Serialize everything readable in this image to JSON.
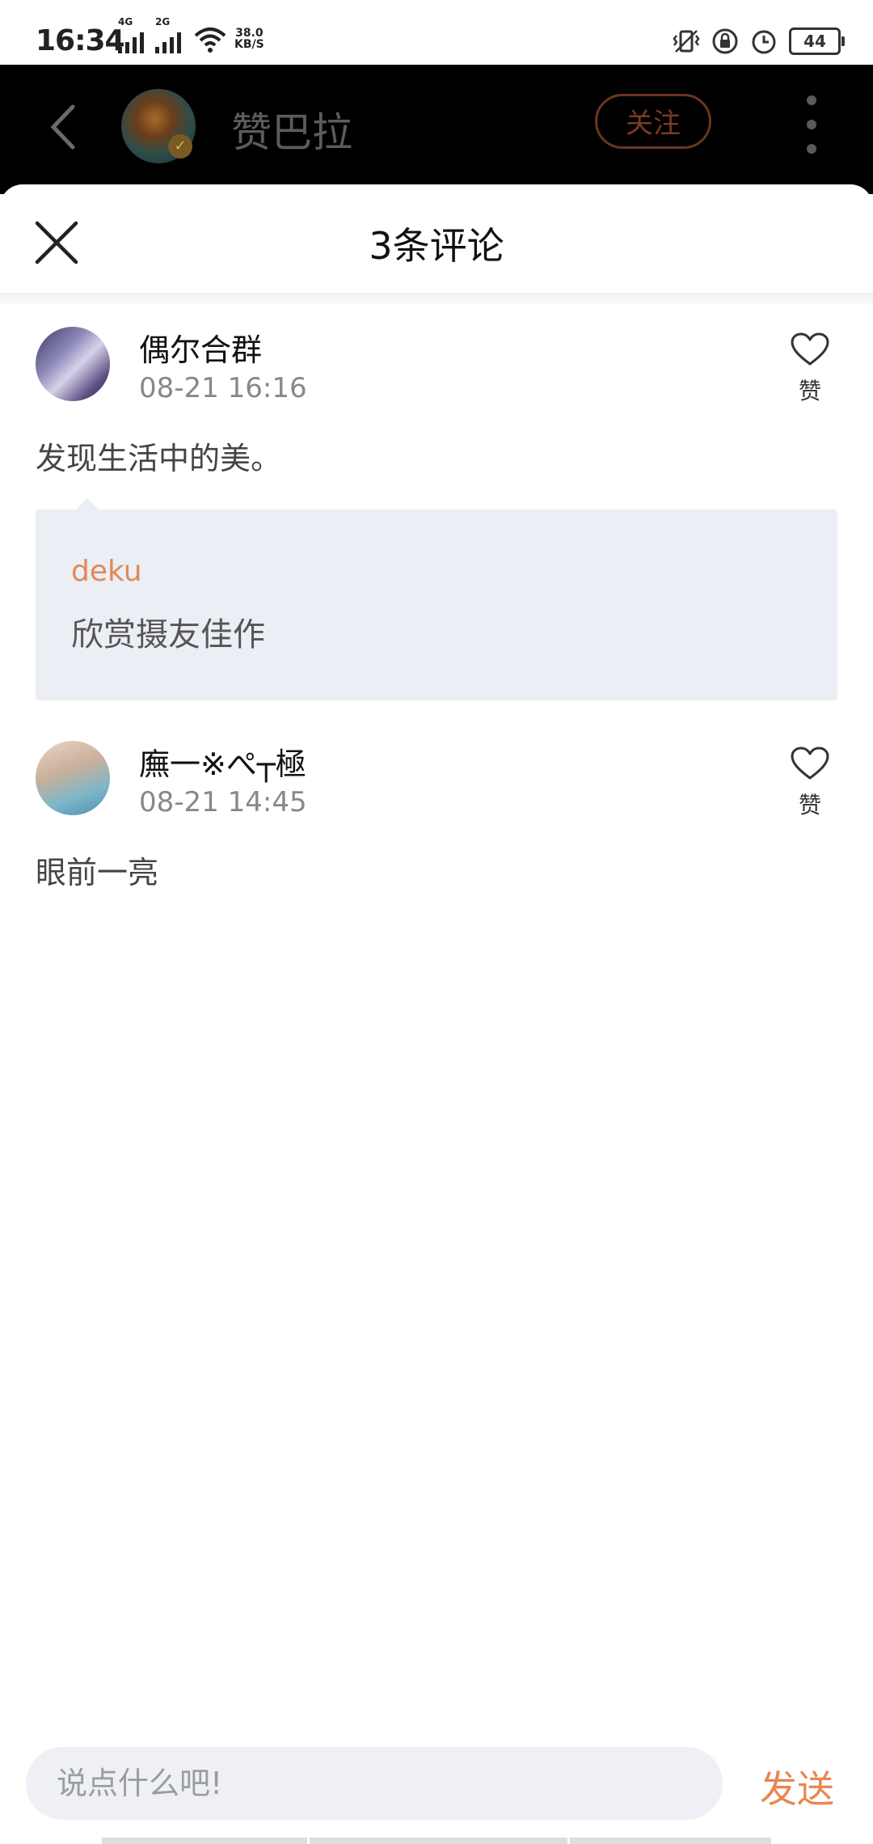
{
  "status_bar": {
    "time": "16:34",
    "network1": "4G",
    "network2": "2G",
    "speed_value": "38.0",
    "speed_unit": "KB/S",
    "battery": "44"
  },
  "header": {
    "author_name": "赞巴拉",
    "follow_label": "关注"
  },
  "sheet": {
    "title": "3条评论"
  },
  "comments": [
    {
      "user": "偶尔合群",
      "time": "08-21 16:16",
      "text": "发现生活中的美。",
      "like_label": "赞",
      "reply": {
        "user": "deku",
        "text": "欣赏摄友佳作"
      }
    },
    {
      "user": "廡一※ぺ┬極",
      "time": "08-21 14:45",
      "text": "眼前一亮",
      "like_label": "赞"
    }
  ],
  "input": {
    "placeholder": "说点什么吧!",
    "send_label": "发送"
  },
  "colors": {
    "accent": "#e7874f",
    "reply_bg": "#eceef5",
    "input_bg": "#eff0f5"
  }
}
